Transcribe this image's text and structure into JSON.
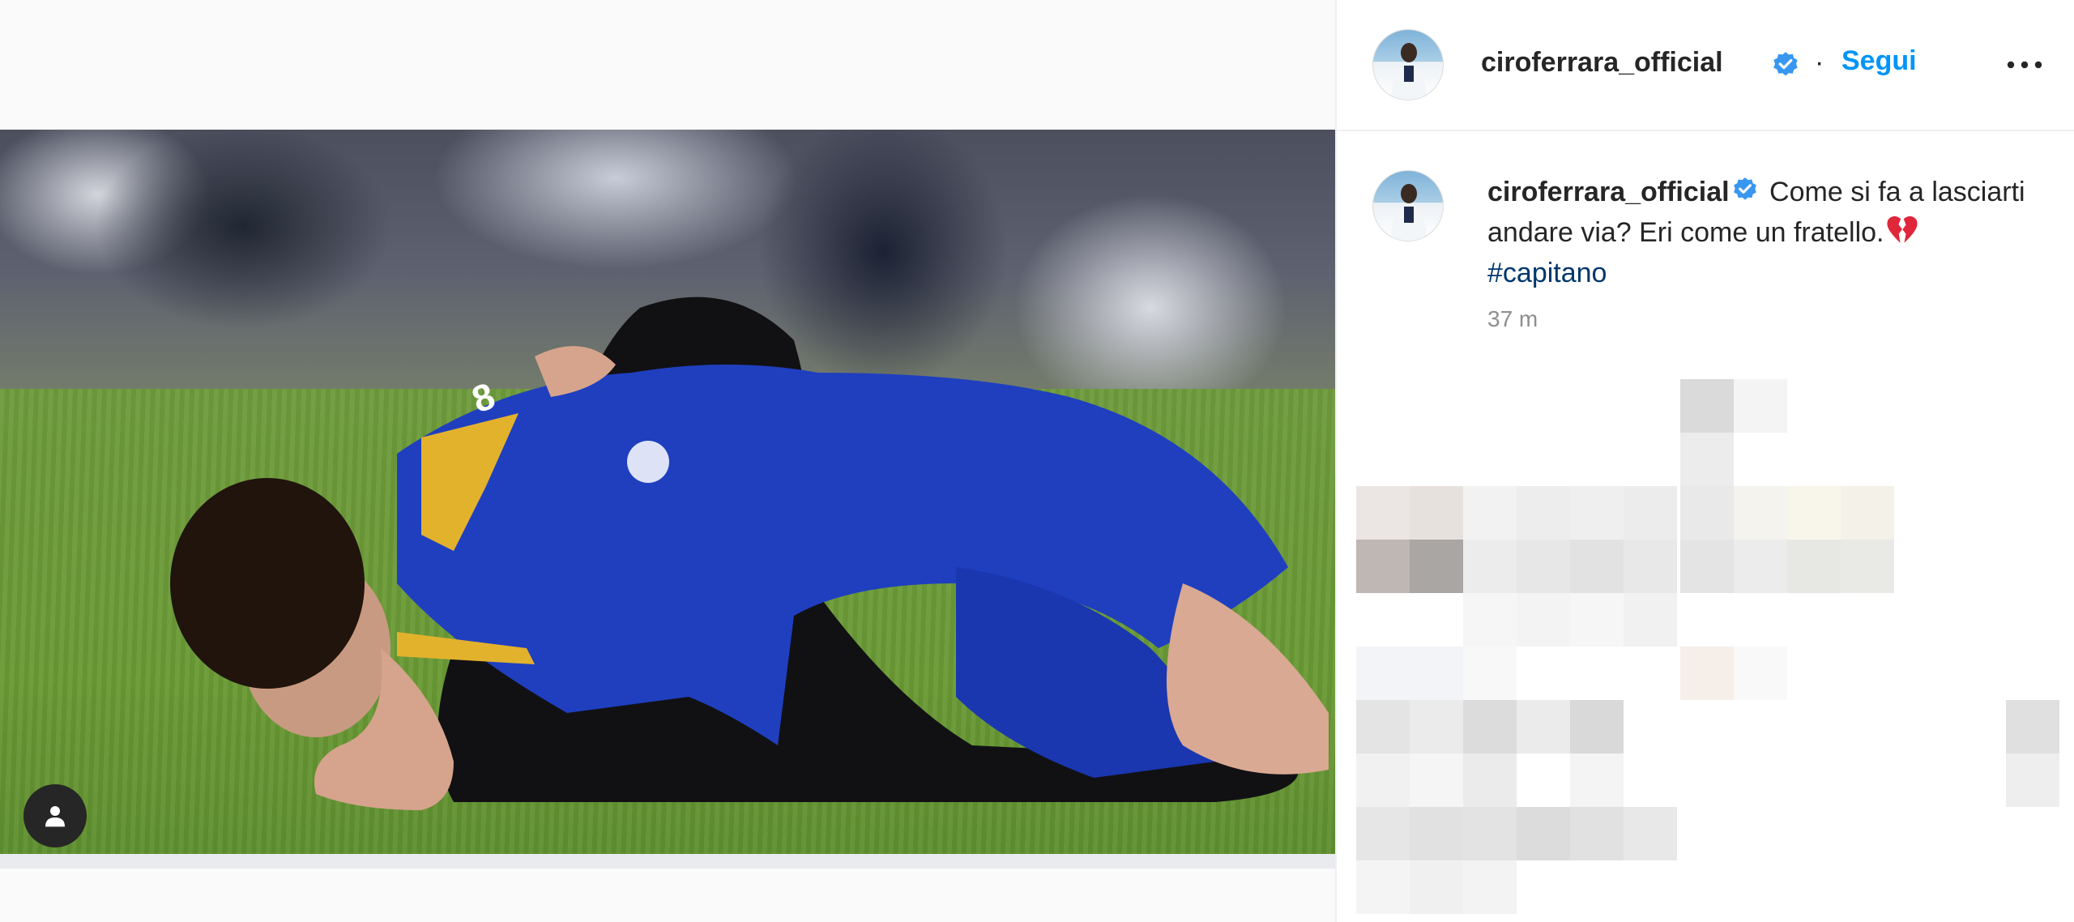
{
  "post": {
    "username": "ciroferrara_official",
    "follow_label": "Segui",
    "separator": "·",
    "caption": {
      "username": "ciroferrara_official",
      "text_before_emoji": "Come si fa a lasciarti andare via? Eri come un fratello.",
      "emoji": "broken-heart",
      "hashtag": "#capitano"
    },
    "timestamp": "37 m"
  },
  "icons": {
    "verified": "verified-badge-icon",
    "more": "more-options-icon",
    "tagged_user": "user-icon"
  },
  "colors": {
    "accent_blue": "#0095f6",
    "verified_blue": "#3897f0",
    "hashtag_blue": "#00376b",
    "text": "#262626",
    "muted": "#8e8e8e"
  }
}
